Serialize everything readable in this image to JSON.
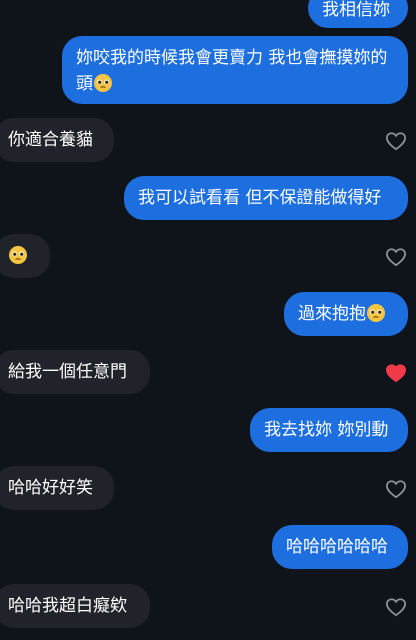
{
  "messages": [
    {
      "side": "out",
      "text": "我相信妳",
      "emoji": false
    },
    {
      "side": "out",
      "text": "妳咬我的時候我會更賣力 我也會撫摸妳的頭",
      "emoji": true
    },
    {
      "side": "in",
      "text": "你適合養貓",
      "emoji": false,
      "liked": false
    },
    {
      "side": "out",
      "text": "我可以試看看 但不保證能做得好",
      "emoji": false
    },
    {
      "side": "in",
      "text": "",
      "emoji": true,
      "liked": false
    },
    {
      "side": "out",
      "text": "過來抱抱",
      "emoji": true
    },
    {
      "side": "in",
      "text": "給我一個任意門",
      "emoji": false,
      "liked": true
    },
    {
      "side": "out",
      "text": "我去找妳 妳別動",
      "emoji": false
    },
    {
      "side": "in",
      "text": "哈哈好好笑",
      "emoji": false,
      "liked": false
    },
    {
      "side": "out",
      "text": "哈哈哈哈哈哈",
      "emoji": false
    },
    {
      "side": "in",
      "text": "哈哈我超白癡欸",
      "emoji": false,
      "liked": false
    }
  ],
  "colors": {
    "outgoing": "#1d6fe0",
    "incoming": "#202329",
    "heart_liked": "#f03a4a",
    "heart_outline": "#8a8f96"
  },
  "icons": {
    "emoji": "pleading-face-icon",
    "heart": "heart-icon"
  }
}
